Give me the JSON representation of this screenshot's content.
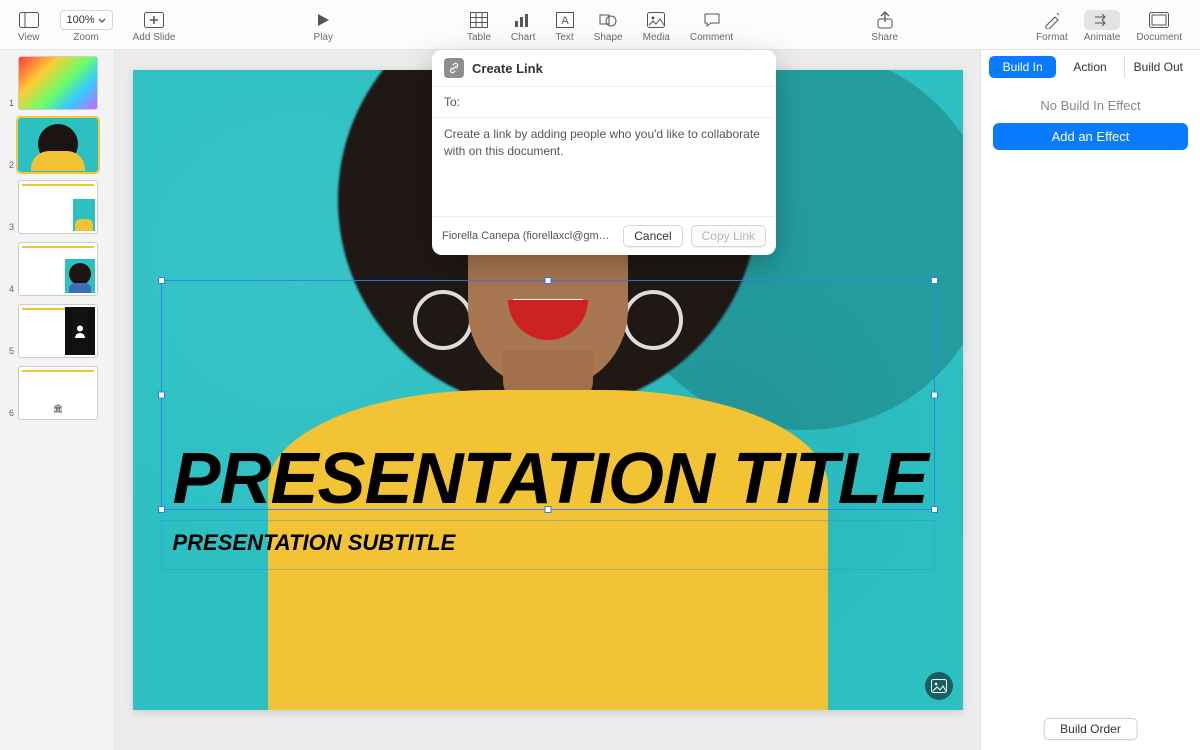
{
  "toolbar": {
    "view": "View",
    "zoom_value": "100%",
    "zoom": "Zoom",
    "add_slide": "Add Slide",
    "play": "Play",
    "table": "Table",
    "chart": "Chart",
    "text": "Text",
    "shape": "Shape",
    "media": "Media",
    "comment": "Comment",
    "share": "Share",
    "format": "Format",
    "animate": "Animate",
    "document": "Document"
  },
  "navigator": {
    "slides": [
      {
        "num": "1"
      },
      {
        "num": "2"
      },
      {
        "num": "3"
      },
      {
        "num": "4"
      },
      {
        "num": "5"
      },
      {
        "num": "6"
      }
    ],
    "selected_index": 1
  },
  "slide": {
    "title": "PRESENTATION TITLE",
    "subtitle": "PRESENTATION SUBTITLE",
    "bg_color": "#2cc0c3",
    "accent_color": "#f2c335"
  },
  "inspector": {
    "tabs": {
      "build_in": "Build In",
      "action": "Action",
      "build_out": "Build Out"
    },
    "active_tab": "build_in",
    "message": "No Build In Effect",
    "add_effect": "Add an Effect",
    "build_order": "Build Order"
  },
  "popover": {
    "title": "Create Link",
    "to_label": "To:",
    "to_value": "",
    "description": "Create a link by adding people who you'd like to collaborate with on this document.",
    "user": "Fiorella Canepa (fiorellaxcl@gmail.com)",
    "cancel": "Cancel",
    "copy_link": "Copy Link"
  }
}
